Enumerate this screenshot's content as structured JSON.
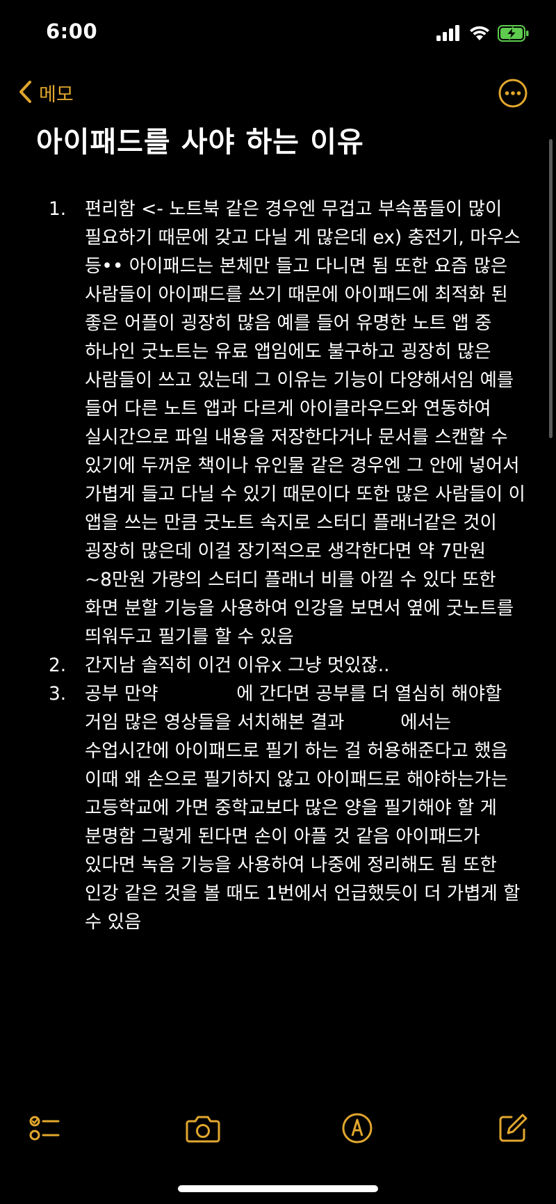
{
  "status_bar": {
    "time": "6:00"
  },
  "nav": {
    "back_label": "메모"
  },
  "note": {
    "title": "아이패드를 사야 하는 이유",
    "items": [
      {
        "number": "1.",
        "text": "편리함 <- 노트북 같은 경우엔 무겁고 부속품들이 많이 필요하기 때문에 갖고 다닐 게 많은데 ex) 충전기, 마우스 등•• 아이패드는 본체만 들고 다니면 됨 또한 요즘 많은 사람들이 아이패드를 쓰기 때문에 아이패드에 최적화 된 좋은 어플이 굉장히 많음 예를 들어 유명한 노트 앱 중 하나인 굿노트는 유료 앱임에도 불구하고 굉장히 많은 사람들이 쓰고 있는데 그 이유는 기능이 다양해서임 예를 들어 다른 노트 앱과 다르게 아이클라우드와 연동하여 실시간으로 파일 내용을 저장한다거나 문서를 스캔할 수 있기에 두꺼운 책이나 유인물 같은 경우엔 그 안에 넣어서 가볍게 들고 다닐 수 있기 때문이다 또한 많은 사람들이 이 앱을 쓰는 만큼 굿노트 속지로 스터디 플래너같은 것이 굉장히 많은데 이걸 장기적으로 생각한다면 약 7만원~8만원 가량의 스터디 플래너 비를 아낄 수 있다 또한 화면 분할 기능을 사용하여 인강을 보면서 옆에 굿노트를 띄워두고 필기를 할 수 있음"
      },
      {
        "number": "2.",
        "text": "간지남 솔직히 이건 이유x 그냥 멋있잖.."
      },
      {
        "number": "3.",
        "text_a": "공부 만약 ",
        "text_b": " 에 간다면 공부를 더 열심히 해야할 거임 많은 영상들을 서치해본 결과 ",
        "text_c": " 에서는 수업시간에 아이패드로 필기 하는 걸 허용해준다고 했음 이때 왜 손으로 필기하지 않고 아이패드로 해야하는가는 고등학교에 가면 중학교보다 많은 양을 필기해야 할 게 분명함 그렇게 된다면 손이 아플 것 같음 아이패드가 있다면 녹음 기능을 사용하여 나중에 정리해도 됨 또한 인강 같은 것을 볼 때도 1번에서 언급했듯이 더 가볍게 할 수 있음"
      }
    ]
  },
  "toolbar": {
    "icons": [
      "checklist-icon",
      "camera-icon",
      "markup-pen-icon",
      "compose-icon"
    ]
  },
  "colors": {
    "accent": "#e2a72e",
    "background": "#000000",
    "text": "#ffffff",
    "battery": "#5ecb4f"
  }
}
